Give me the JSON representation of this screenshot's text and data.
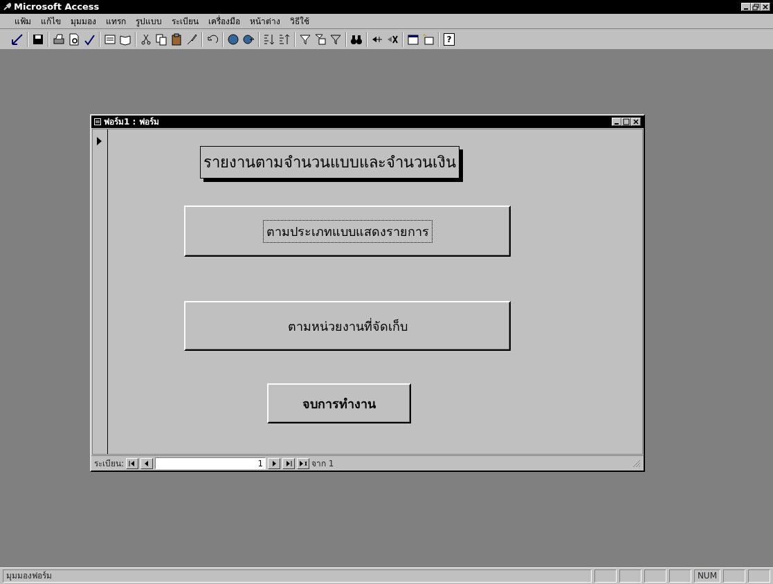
{
  "window": {
    "title": "Microsoft Access"
  },
  "menu": [
    "แฟ้ม",
    "แก้ไข",
    "มุมมอง",
    "แทรก",
    "รูปแบบ",
    "ระเบียน",
    "เครื่องมือ",
    "หน้าต่าง",
    "วิธีใช้"
  ],
  "form_window": {
    "title": "ฟอร์ม1 : ฟอร์ม",
    "heading": "รายงานตามจำนวนแบบและจำนวนเงิน",
    "buttons": [
      {
        "label": "ตามประเภทแบบแสดงรายการ",
        "focused": true
      },
      {
        "label": "ตามหน่วยงานที่จัดเก็บ",
        "focused": false
      }
    ],
    "exit_button": "จบการทำงาน",
    "navigator": {
      "label": "ระเบียน:",
      "record": "1",
      "of_label": "จาก 1"
    }
  },
  "toolbar": {
    "help_button": "?"
  },
  "status_bar": {
    "text": "มุมมองฟอร์ม",
    "num_indicator": "NUM"
  }
}
